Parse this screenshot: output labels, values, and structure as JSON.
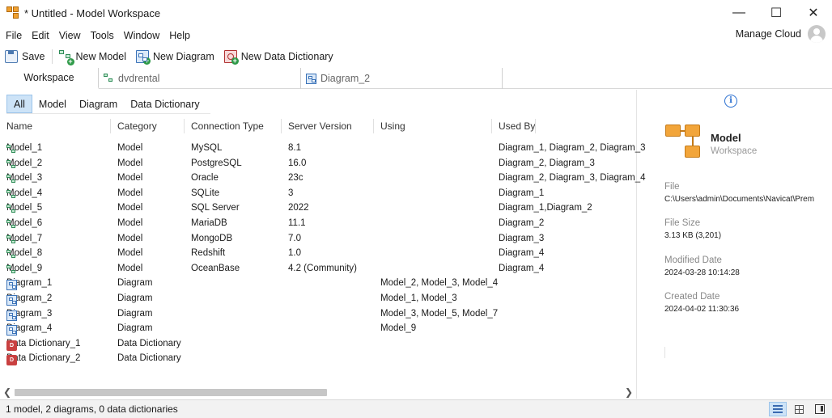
{
  "window": {
    "title": "* Untitled - Model Workspace",
    "minimize": "—",
    "maximize": "☐",
    "close": "✕"
  },
  "menu": [
    "File",
    "Edit",
    "View",
    "Tools",
    "Window",
    "Help"
  ],
  "cloud": {
    "label": "Manage Cloud"
  },
  "toolbar": {
    "save": "Save",
    "new_model": "New Model",
    "new_diagram": "New Diagram",
    "new_dictionary": "New Data Dictionary"
  },
  "tabs": [
    {
      "label": "Workspace",
      "active": true
    },
    {
      "label": "dvdrental",
      "icon": "model-icon"
    },
    {
      "label": "Diagram_2",
      "icon": "diagram-icon"
    }
  ],
  "filters": [
    "All",
    "Model",
    "Diagram",
    "Data Dictionary"
  ],
  "columns": [
    "Name",
    "Category",
    "Connection Type",
    "Server Version",
    "Using",
    "Used By"
  ],
  "rows": [
    {
      "type": "model",
      "name": "Model_1",
      "category": "Model",
      "connection": "MySQL",
      "version": "8.1",
      "using": "",
      "used_by": "Diagram_1, Diagram_2, Diagram_3"
    },
    {
      "type": "model",
      "name": "Model_2",
      "category": "Model",
      "connection": "PostgreSQL",
      "version": "16.0",
      "using": "",
      "used_by": "Diagram_2, Diagram_3"
    },
    {
      "type": "model",
      "name": "Model_3",
      "category": "Model",
      "connection": "Oracle",
      "version": "23c",
      "using": "",
      "used_by": "Diagram_2, Diagram_3, Diagram_4"
    },
    {
      "type": "model",
      "name": "Model_4",
      "category": "Model",
      "connection": "SQLite",
      "version": "3",
      "using": "",
      "used_by": "Diagram_1"
    },
    {
      "type": "model",
      "name": "Model_5",
      "category": "Model",
      "connection": "SQL Server",
      "version": "2022",
      "using": "",
      "used_by": "Diagram_1,Diagram_2"
    },
    {
      "type": "model",
      "name": "Model_6",
      "category": "Model",
      "connection": "MariaDB",
      "version": "11.1",
      "using": "",
      "used_by": "Diagram_2"
    },
    {
      "type": "model",
      "name": "Model_7",
      "category": "Model",
      "connection": "MongoDB",
      "version": "7.0",
      "using": "",
      "used_by": "Diagram_3"
    },
    {
      "type": "model",
      "name": "Model_8",
      "category": "Model",
      "connection": "Redshift",
      "version": "1.0",
      "using": "",
      "used_by": "Diagram_4"
    },
    {
      "type": "model",
      "name": "Model_9",
      "category": "Model",
      "connection": "OceanBase",
      "version": "4.2 (Community)",
      "using": "",
      "used_by": "Diagram_4"
    },
    {
      "type": "diagram",
      "name": "Diagram_1",
      "category": "Diagram",
      "connection": "",
      "version": "",
      "using": "Model_2, Model_3, Model_4",
      "used_by": ""
    },
    {
      "type": "diagram",
      "name": "Diagram_2",
      "category": "Diagram",
      "connection": "",
      "version": "",
      "using": "Model_1, Model_3",
      "used_by": ""
    },
    {
      "type": "diagram",
      "name": "Diagram_3",
      "category": "Diagram",
      "connection": "",
      "version": "",
      "using": "Model_3, Model_5, Model_7",
      "used_by": ""
    },
    {
      "type": "diagram",
      "name": "Diagram_4",
      "category": "Diagram",
      "connection": "",
      "version": "",
      "using": "Model_9",
      "used_by": ""
    },
    {
      "type": "dict",
      "name": "Data Dictionary_1",
      "category": "Data Dictionary",
      "connection": "",
      "version": "",
      "using": "",
      "used_by": ""
    },
    {
      "type": "dict",
      "name": "Data Dictionary_2",
      "category": "Data Dictionary",
      "connection": "",
      "version": "",
      "using": "",
      "used_by": ""
    }
  ],
  "details": {
    "type": "Model",
    "subtitle": "Workspace",
    "file_label": "File",
    "file_value": "C:\\Users\\admin\\Documents\\Navicat\\Prem",
    "size_label": "File Size",
    "size_value": "3.13 KB (3,201)",
    "modified_label": "Modified Date",
    "modified_value": "2024-03-28 10:14:28",
    "created_label": "Created Date",
    "created_value": "2024-04-02 11:30:36"
  },
  "status": {
    "text": "1 model, 2 diagrams, 0 data dictionaries"
  },
  "colors": {
    "accent": "#2a6fd0",
    "selection": "#cde3f7",
    "model_green": "#2e8b57",
    "folder_orange": "#f2a53a"
  }
}
